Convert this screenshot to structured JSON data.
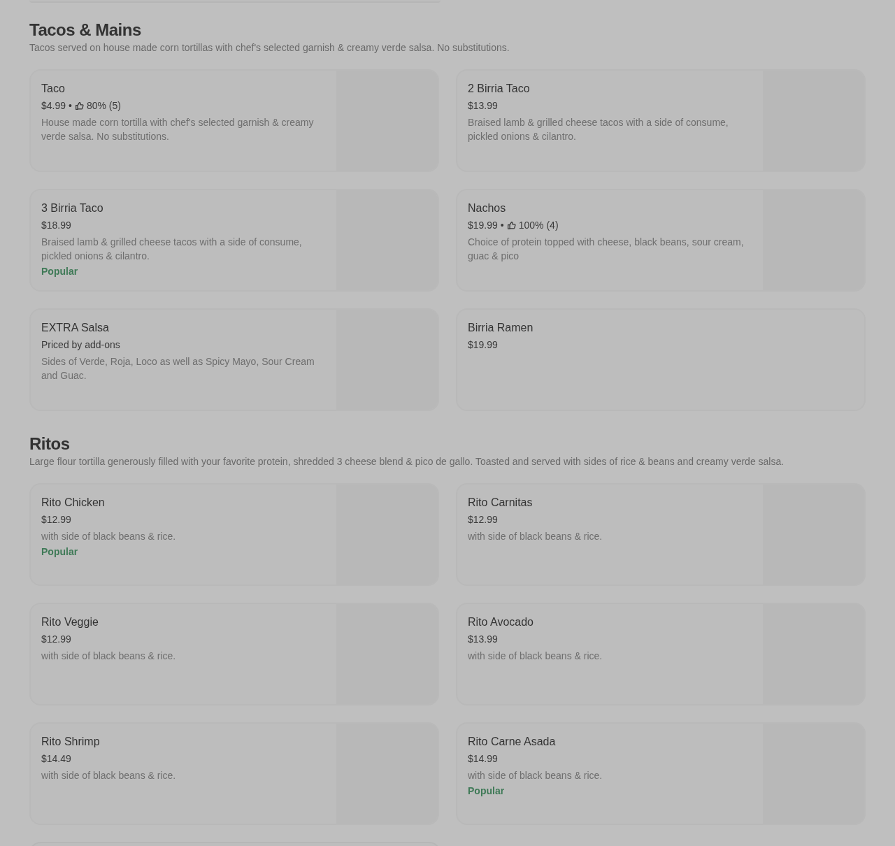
{
  "sections": [
    {
      "title": "Tacos & Mains",
      "description": "Tacos served on house made corn tortillas with chef's selected garnish & creamy verde salsa. No substitutions.",
      "items": [
        {
          "name": "Taco",
          "price": "$4.99",
          "rating": {
            "separator": "•",
            "text": "80% (5)"
          },
          "description": "House made corn tortilla with chef's selected garnish & creamy verde salsa. No substitutions.",
          "has_image": true
        },
        {
          "name": "2 Birria Taco",
          "price": "$13.99",
          "description": "Braised lamb & grilled cheese tacos with a side of consume, pickled onions & cilantro.",
          "has_image": true
        },
        {
          "name": "3 Birria Taco",
          "price": "$18.99",
          "description": "Braised lamb & grilled cheese tacos with a side of consume, pickled onions & cilantro.",
          "badge": "Popular",
          "has_image": true
        },
        {
          "name": "Nachos",
          "price": "$19.99",
          "rating": {
            "separator": "•",
            "text": "100% (4)"
          },
          "description": "Choice of protein topped with cheese, black beans, sour cream, guac & pico",
          "has_image": true
        },
        {
          "name": "EXTRA Salsa",
          "price": "Priced by add-ons",
          "description": "Sides of Verde, Roja, Loco as well as Spicy Mayo, Sour Cream and Guac.",
          "has_image": true
        },
        {
          "name": "Birria Ramen",
          "price": "$19.99",
          "has_image": false
        }
      ]
    },
    {
      "title": "Ritos",
      "description": "Large flour tortilla generously filled with your favorite protein, shredded 3 cheese blend & pico de gallo. Toasted and served with sides of rice & beans and creamy verde salsa.",
      "items": [
        {
          "name": "Rito Chicken",
          "price": "$12.99",
          "description": "with side of black beans & rice.",
          "badge": "Popular",
          "has_image": true
        },
        {
          "name": "Rito Carnitas",
          "price": "$12.99",
          "description": "with side of black beans & rice.",
          "has_image": true
        },
        {
          "name": "Rito Veggie",
          "price": "$12.99",
          "description": "with side of black beans & rice.",
          "has_image": true
        },
        {
          "name": "Rito Avocado",
          "price": "$13.99",
          "description": "with side of black beans & rice.",
          "has_image": true
        },
        {
          "name": "Rito Shrimp",
          "price": "$14.49",
          "description": "with side of black beans & rice.",
          "has_image": true
        },
        {
          "name": "Rito Carne Asada",
          "price": "$14.99",
          "description": "with side of black beans & rice.",
          "badge": "Popular",
          "has_image": true
        }
      ]
    }
  ]
}
